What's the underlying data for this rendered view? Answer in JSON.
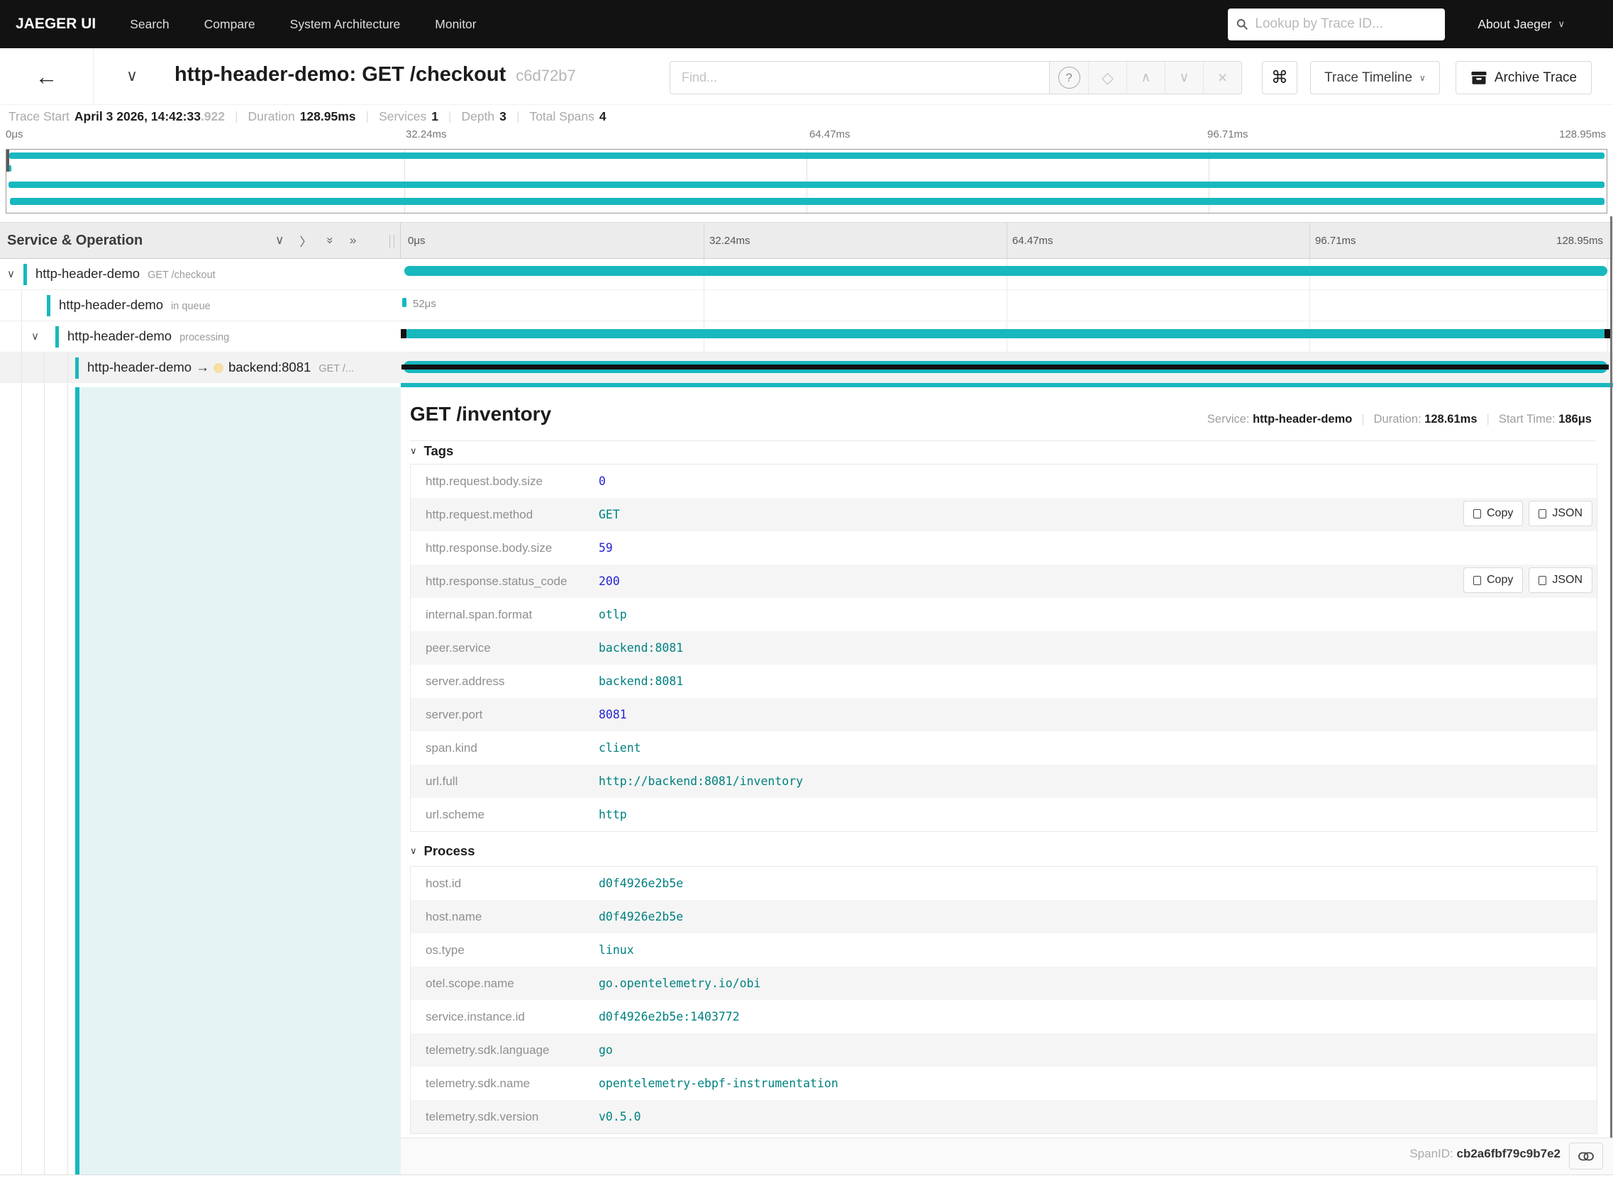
{
  "nav": {
    "brand": "JAEGER UI",
    "items": [
      {
        "label": "Search"
      },
      {
        "label": "Compare"
      },
      {
        "label": "System Architecture"
      },
      {
        "label": "Monitor"
      }
    ],
    "search_placeholder": "Lookup by Trace ID...",
    "about_label": "About Jaeger"
  },
  "trace_header": {
    "title": "http-header-demo: GET /checkout",
    "trace_id": "c6d72b7",
    "find_placeholder": "Find...",
    "shortcut_label": "⌘",
    "view_mode": "Trace Timeline",
    "archive_label": "Archive Trace"
  },
  "trace_meta": {
    "trace_start_label": "Trace Start",
    "trace_start_value": "April 3 2026, 14:42:33",
    "trace_start_ms": ".922",
    "duration_label": "Duration",
    "duration_value": "128.95ms",
    "services_label": "Services",
    "services_value": "1",
    "depth_label": "Depth",
    "depth_value": "3",
    "total_spans_label": "Total Spans",
    "total_spans_value": "4"
  },
  "timeline": {
    "header_label": "Service & Operation",
    "ticks": [
      "0μs",
      "32.24ms",
      "64.47ms",
      "96.71ms",
      "128.95ms"
    ]
  },
  "spans": [
    {
      "service": "http-header-demo",
      "operation": "GET /checkout"
    },
    {
      "service": "http-header-demo",
      "operation": "in queue",
      "duration_label": "52μs"
    },
    {
      "service": "http-header-demo",
      "operation": "processing"
    },
    {
      "service": "http-header-demo",
      "peer": "backend:8081",
      "operation": "GET /..."
    }
  ],
  "detail": {
    "title": "GET /inventory",
    "service_label": "Service:",
    "service": "http-header-demo",
    "duration_label": "Duration:",
    "duration": "128.61ms",
    "start_label": "Start Time:",
    "start": "186μs",
    "tags_title": "Tags",
    "copy_label": "Copy",
    "json_label": "JSON",
    "tags": [
      {
        "key": "http.request.body.size",
        "value": "0",
        "type": "number"
      },
      {
        "key": "http.request.method",
        "value": "GET",
        "type": "string"
      },
      {
        "key": "http.response.body.size",
        "value": "59",
        "type": "number"
      },
      {
        "key": "http.response.status_code",
        "value": "200",
        "type": "number"
      },
      {
        "key": "internal.span.format",
        "value": "otlp",
        "type": "string"
      },
      {
        "key": "peer.service",
        "value": "backend:8081",
        "type": "string"
      },
      {
        "key": "server.address",
        "value": "backend:8081",
        "type": "string"
      },
      {
        "key": "server.port",
        "value": "8081",
        "type": "number"
      },
      {
        "key": "span.kind",
        "value": "client",
        "type": "string"
      },
      {
        "key": "url.full",
        "value": "http://backend:8081/inventory",
        "type": "string"
      },
      {
        "key": "url.scheme",
        "value": "http",
        "type": "string"
      }
    ],
    "process_title": "Process",
    "process": [
      {
        "key": "host.id",
        "value": "d0f4926e2b5e",
        "type": "string"
      },
      {
        "key": "host.name",
        "value": "d0f4926e2b5e",
        "type": "string"
      },
      {
        "key": "os.type",
        "value": "linux",
        "type": "string"
      },
      {
        "key": "otel.scope.name",
        "value": "go.opentelemetry.io/obi",
        "type": "string"
      },
      {
        "key": "service.instance.id",
        "value": "d0f4926e2b5e:1403772",
        "type": "string"
      },
      {
        "key": "telemetry.sdk.language",
        "value": "go",
        "type": "string"
      },
      {
        "key": "telemetry.sdk.name",
        "value": "opentelemetry-ebpf-instrumentation",
        "type": "string"
      },
      {
        "key": "telemetry.sdk.version",
        "value": "v0.5.0",
        "type": "string"
      }
    ],
    "span_id_label": "SpanID:",
    "span_id": "cb2a6fbf79c9b7e2"
  },
  "colors": {
    "accent_teal": "#17b8be",
    "service_dot_tan": "#f8dda4",
    "json_string": "#008080",
    "json_number": "#2525d2",
    "nav_background": "#121212"
  }
}
